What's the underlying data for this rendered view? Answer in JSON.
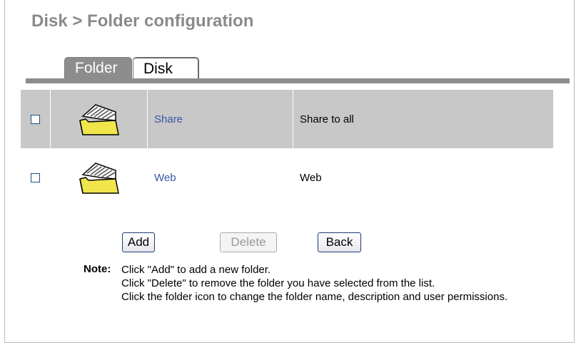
{
  "page": {
    "title": "Disk > Folder configuration"
  },
  "tabs": [
    {
      "label": "Folder",
      "active": true
    },
    {
      "label": "Disk",
      "active": false
    }
  ],
  "folders": [
    {
      "name": "Share",
      "description": "Share to all",
      "checked": false,
      "icon": "folder-icon"
    },
    {
      "name": "Web",
      "description": "Web",
      "checked": false,
      "icon": "folder-icon"
    }
  ],
  "buttons": {
    "add": "Add",
    "delete": "Delete",
    "back": "Back"
  },
  "note": {
    "label": "Note:",
    "lines": [
      "Click \"Add\" to add a new folder.",
      "Click \"Delete\" to remove the folder you have selected from the list.",
      "Click the folder icon to change the folder name, description and user permissions."
    ]
  },
  "colors": {
    "tab_active_bg": "#8d8d8d",
    "shaded_row": "#c8c8c8",
    "link": "#3a56a0",
    "title": "#8a8a8a"
  }
}
